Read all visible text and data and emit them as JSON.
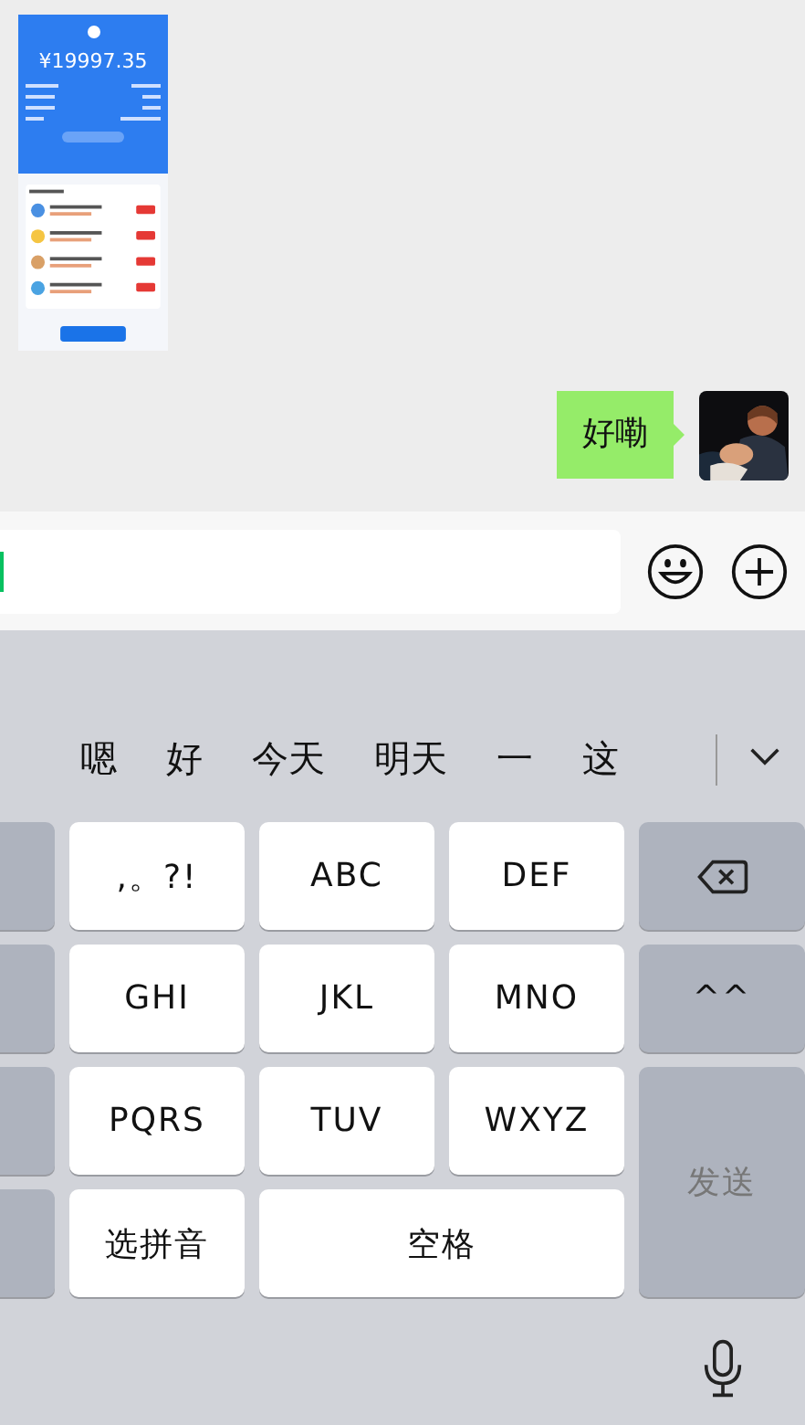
{
  "chat": {
    "messages": [
      {
        "kind": "screenshot",
        "amount": "¥19997.35"
      },
      {
        "kind": "text",
        "text": "好嘞",
        "outgoing": true
      }
    ]
  },
  "candidates": [
    "嗯",
    "好",
    "今天",
    "明天",
    "一",
    "这"
  ],
  "keys": [
    {
      "kind": "side"
    },
    {
      "kind": "letter",
      "label": ",。?!"
    },
    {
      "kind": "letter",
      "label": "ABC"
    },
    {
      "kind": "letter",
      "label": "DEF"
    },
    {
      "kind": "delete"
    },
    {
      "kind": "side"
    },
    {
      "kind": "letter",
      "label": "GHI"
    },
    {
      "kind": "letter",
      "label": "JKL"
    },
    {
      "kind": "letter",
      "label": "MNO"
    },
    {
      "kind": "function",
      "label": "^^"
    },
    {
      "kind": "side"
    },
    {
      "kind": "letter",
      "label": "PQRS"
    },
    {
      "kind": "letter",
      "label": "TUV"
    },
    {
      "kind": "letter",
      "label": "WXYZ"
    },
    {
      "kind": "send",
      "label": "发送"
    },
    {
      "kind": "side"
    },
    {
      "kind": "letter",
      "label": "选拼音"
    },
    {
      "kind": "space",
      "label": "空格"
    }
  ]
}
